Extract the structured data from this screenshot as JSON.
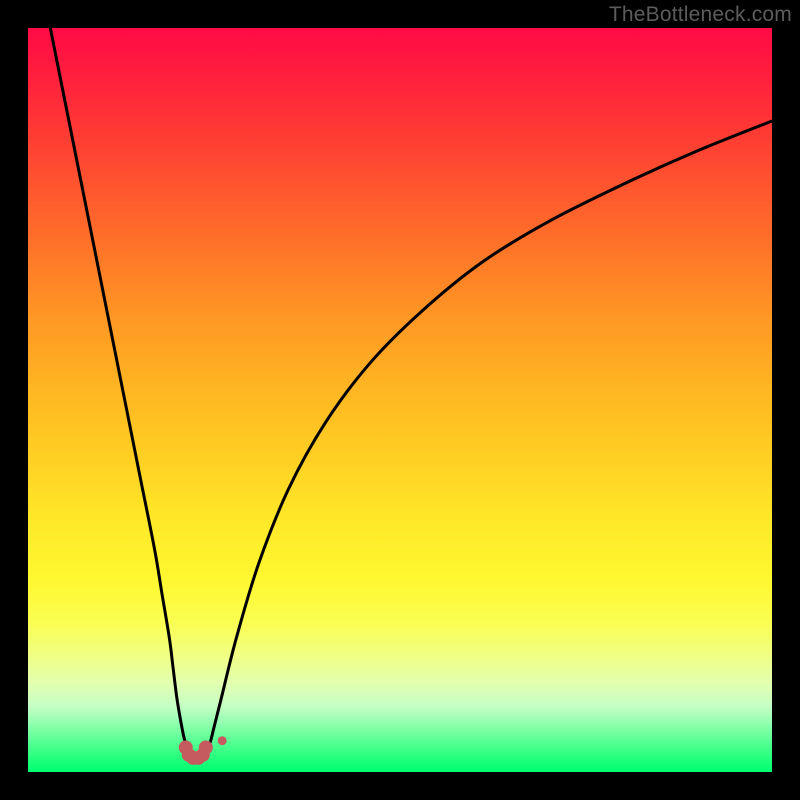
{
  "watermark": "TheBottleneck.com",
  "colors": {
    "frame": "#000000",
    "curve": "#000000",
    "marker": "#c65b5f",
    "gradient_top": "#ff0b45",
    "gradient_bottom": "#00ff70"
  },
  "chart_data": {
    "type": "line",
    "title": "",
    "xlabel": "",
    "ylabel": "",
    "xlim": [
      0,
      100
    ],
    "ylim": [
      0,
      100
    ],
    "grid": false,
    "legend": false,
    "series": [
      {
        "name": "left-branch",
        "x": [
          3,
          5,
          7,
          9,
          11,
          13,
          15,
          17,
          18,
          19,
          19.5,
          20,
          20.5,
          21,
          21.5,
          22,
          22.3
        ],
        "values": [
          100,
          90,
          80,
          70,
          60,
          50,
          40,
          30,
          24,
          18,
          14,
          10,
          7,
          4.5,
          3,
          2.2,
          2
        ]
      },
      {
        "name": "right-branch",
        "x": [
          23.6,
          24,
          24.5,
          25,
          26,
          28,
          31,
          35,
          40,
          46,
          53,
          61,
          70,
          80,
          90,
          100
        ],
        "values": [
          2,
          2.5,
          4,
          6,
          10,
          18,
          28,
          38,
          47,
          55,
          62,
          68.5,
          74,
          79,
          83.5,
          87.5
        ]
      }
    ],
    "markers": [
      {
        "name": "u-marker-left",
        "x": 21.2,
        "y": 3.3,
        "size": 14
      },
      {
        "name": "u-marker-left2",
        "x": 21.6,
        "y": 2.3,
        "size": 14
      },
      {
        "name": "u-marker-mid1",
        "x": 22.2,
        "y": 1.9,
        "size": 14
      },
      {
        "name": "u-marker-mid2",
        "x": 22.9,
        "y": 1.9,
        "size": 14
      },
      {
        "name": "u-marker-right1",
        "x": 23.5,
        "y": 2.3,
        "size": 14
      },
      {
        "name": "u-marker-right2",
        "x": 23.9,
        "y": 3.3,
        "size": 14
      },
      {
        "name": "satellite-dot",
        "x": 26.1,
        "y": 4.2,
        "size": 9
      }
    ]
  }
}
